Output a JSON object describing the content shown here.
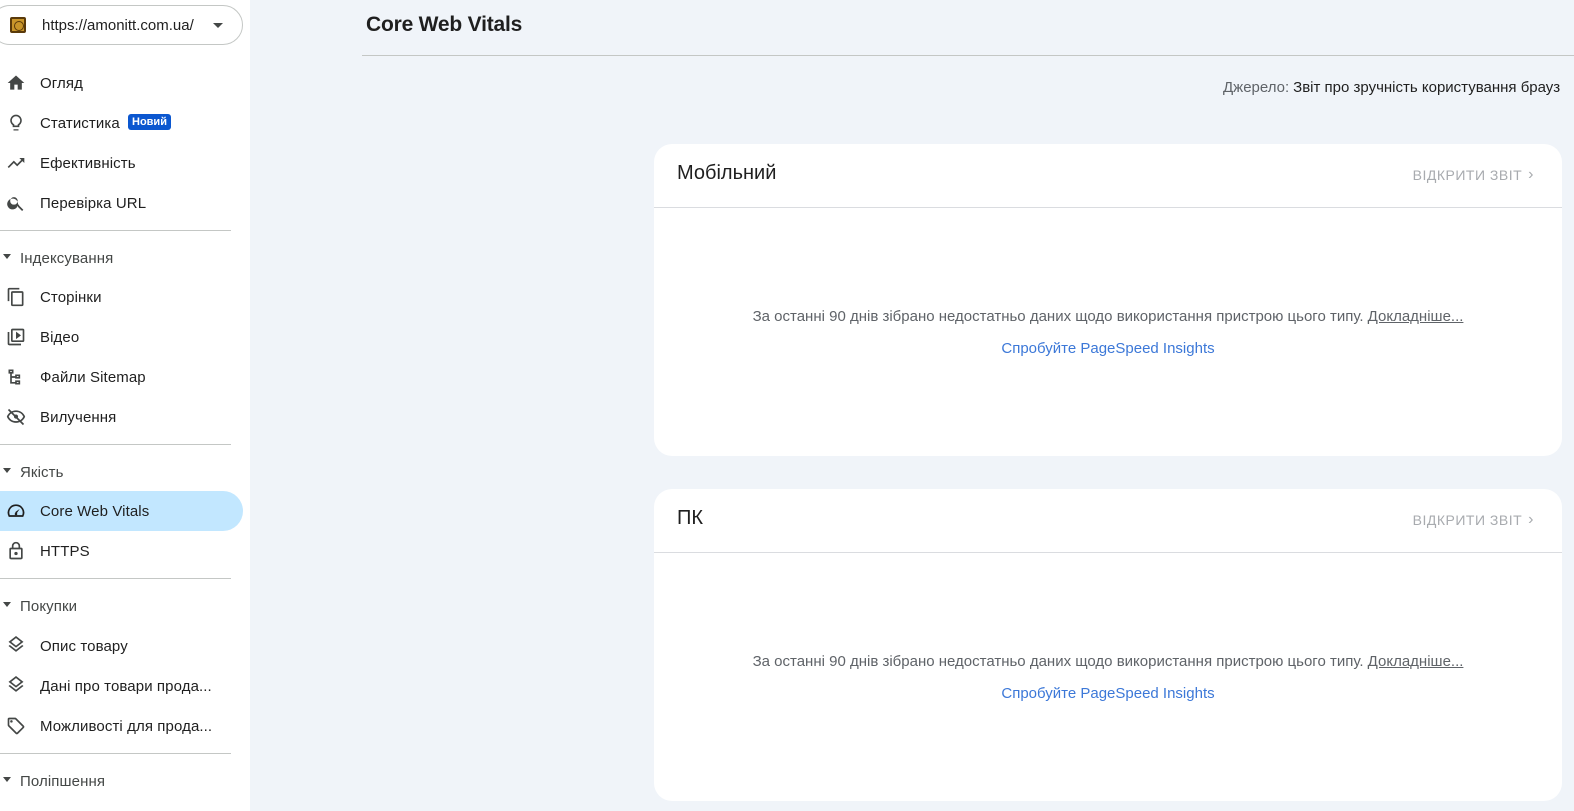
{
  "property": {
    "url": "https://amonitt.com.ua/"
  },
  "sidebar": {
    "top_items": [
      {
        "label": "Огляд",
        "icon": "home-icon"
      },
      {
        "label": "Статистика",
        "icon": "lightbulb-icon",
        "badge": "Новий"
      },
      {
        "label": "Ефективність",
        "icon": "trending-up-icon"
      },
      {
        "label": "Перевірка URL",
        "icon": "search-icon"
      }
    ],
    "sections": [
      {
        "title": "Індексування",
        "items": [
          {
            "label": "Сторінки",
            "icon": "pages-icon"
          },
          {
            "label": "Відео",
            "icon": "video-icon"
          },
          {
            "label": "Файли Sitemap",
            "icon": "sitemap-icon"
          },
          {
            "label": "Вилучення",
            "icon": "eye-off-icon"
          }
        ]
      },
      {
        "title": "Якість",
        "items": [
          {
            "label": "Core Web Vitals",
            "icon": "speed-icon",
            "active": true
          },
          {
            "label": "HTTPS",
            "icon": "lock-icon"
          }
        ]
      },
      {
        "title": "Покупки",
        "items": [
          {
            "label": "Опис товару",
            "icon": "layers-icon"
          },
          {
            "label": "Дані про товари прода...",
            "icon": "layers-icon"
          },
          {
            "label": "Можливості для прода...",
            "icon": "tag-icon"
          }
        ]
      },
      {
        "title": "Поліпшення",
        "items": []
      }
    ]
  },
  "main": {
    "title": "Core Web Vitals",
    "source_label": "Джерело:",
    "source_value": "Звіт про зручність користування брауз",
    "cards": [
      {
        "title": "Мобільний",
        "open_label": "ВІДКРИТИ ЗВІТ",
        "message": "За останні 90 днів зібрано недостатньо даних щодо використання пристрою цього типу.",
        "more_label": "Докладніше...",
        "link": "Спробуйте PageSpeed Insights"
      },
      {
        "title": "ПК",
        "open_label": "ВІДКРИТИ ЗВІТ",
        "message": "За останні 90 днів зібрано недостатньо даних щодо використання пристрою цього типу.",
        "more_label": "Докладніше...",
        "link": "Спробуйте PageSpeed Insights"
      }
    ]
  },
  "colors": {
    "active_bg": "#c2e7ff",
    "badge": "#0b57d0",
    "link": "#3c78d8",
    "page_bg": "#f0f4f9"
  }
}
